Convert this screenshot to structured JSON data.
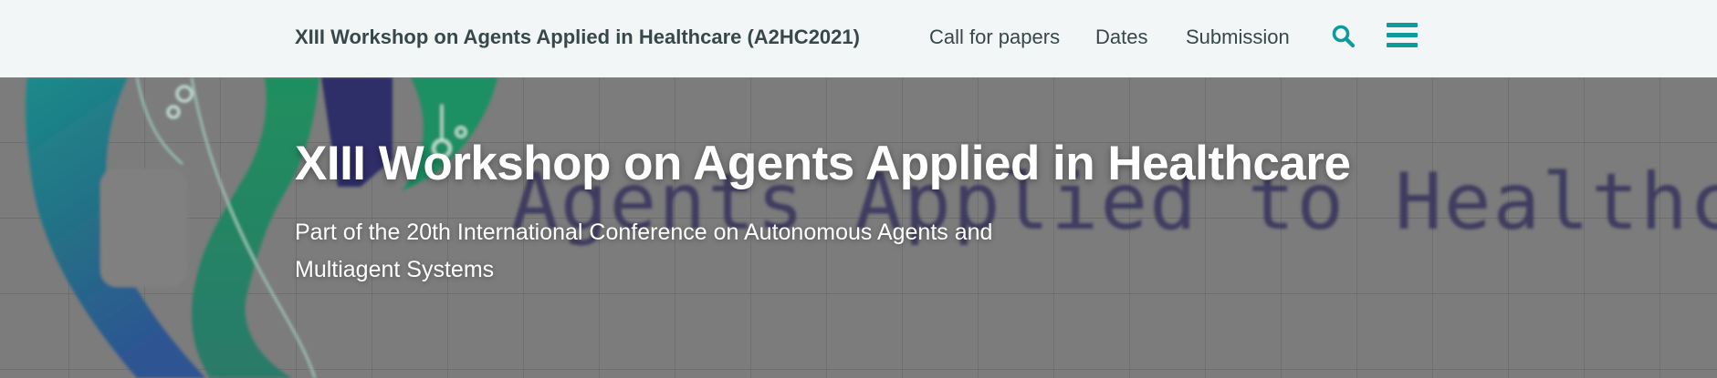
{
  "header": {
    "site_title": "XIII Workshop on Agents Applied in Healthcare (A2HC2021)",
    "nav": [
      {
        "label": "Call for papers"
      },
      {
        "label": "Dates"
      },
      {
        "label": "Submission"
      }
    ],
    "icons": {
      "search": "search-icon",
      "menu": "hamburger-menu-icon"
    },
    "colors": {
      "accent": "#0f9b9b",
      "text": "#37474a",
      "bar_background": "#f2f6f6"
    }
  },
  "hero": {
    "title": "XIII Workshop on Agents Applied in Healthcare",
    "subtitle": "Part of the 20th International Conference on Autonomous Agents and Multiagent Systems",
    "background_text": "Agents Applied to Healthcare"
  }
}
